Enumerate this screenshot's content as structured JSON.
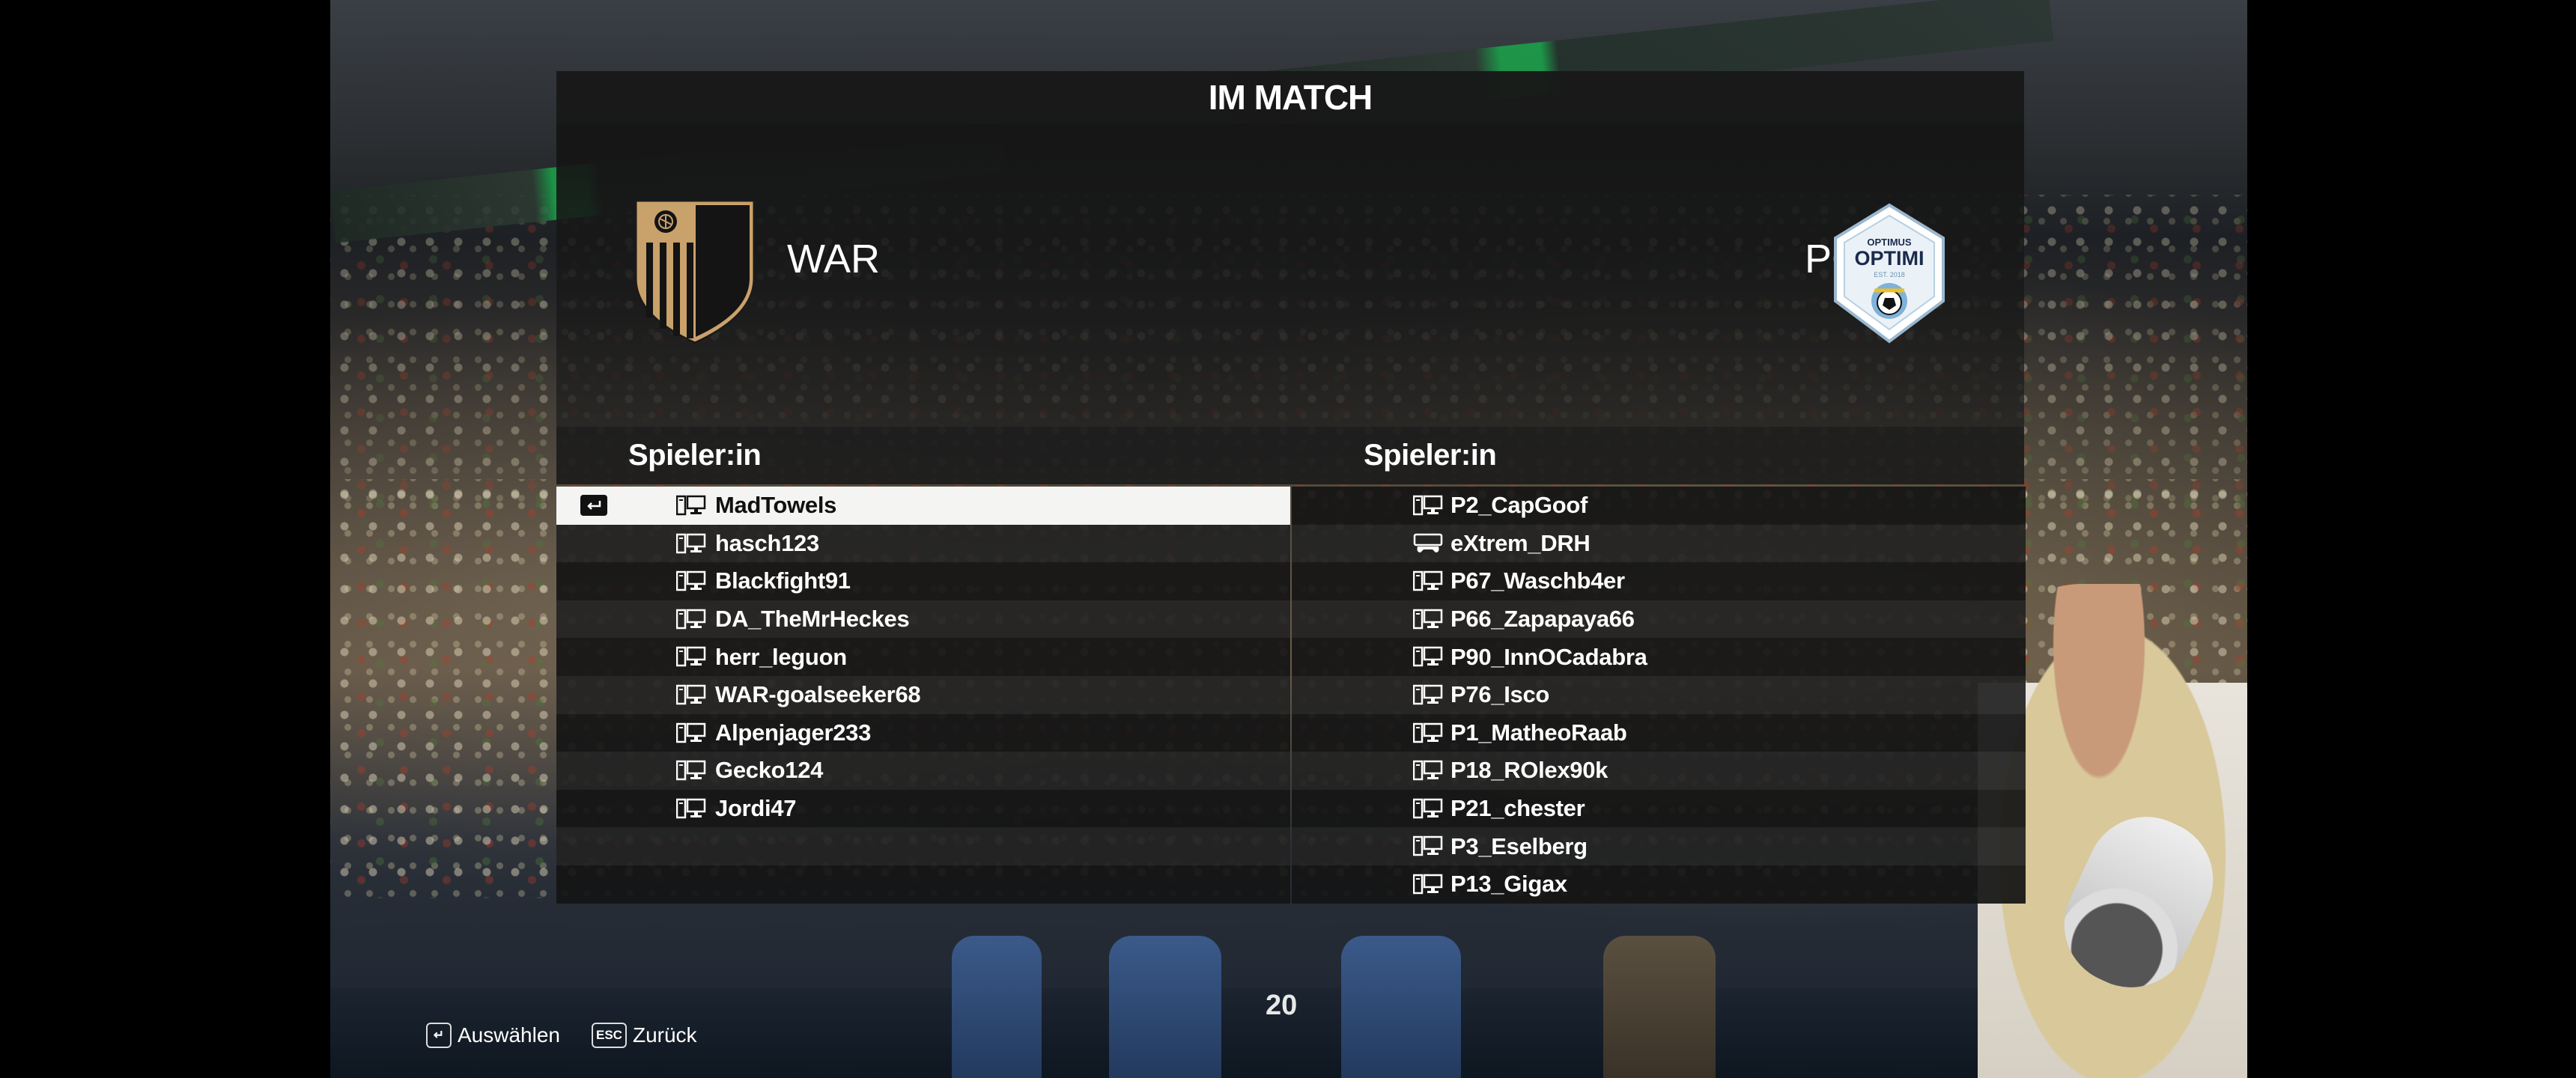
{
  "screen_title": "IM MATCH",
  "home_team": {
    "name": "WAR",
    "crest_icon": "war-shield-crest"
  },
  "away_team": {
    "name": "PG",
    "crest_icon": "optimus-optimi-crest",
    "crest_text_top": "OPTIMUS",
    "crest_text_main": "OPTIMI",
    "crest_text_sub": "EST. 2018"
  },
  "home_column_header": "Spieler:in",
  "away_column_header": "Spieler:in",
  "home_players": [
    {
      "name": "MadTowels",
      "platform": "pc-icon",
      "selected": true
    },
    {
      "name": "hasch123",
      "platform": "pc-icon"
    },
    {
      "name": "Blackfight91",
      "platform": "pc-icon"
    },
    {
      "name": "DA_TheMrHeckes",
      "platform": "pc-icon"
    },
    {
      "name": "herr_leguon",
      "platform": "pc-icon"
    },
    {
      "name": "WAR-goalseeker68",
      "platform": "pc-icon"
    },
    {
      "name": "Alpenjager233",
      "platform": "pc-icon"
    },
    {
      "name": "Gecko124",
      "platform": "pc-icon"
    },
    {
      "name": "Jordi47",
      "platform": "pc-icon"
    }
  ],
  "away_players": [
    {
      "name": "P2_CapGoof",
      "platform": "pc-icon"
    },
    {
      "name": "eXtrem_DRH",
      "platform": "console-icon"
    },
    {
      "name": "P67_Waschb4er",
      "platform": "pc-icon"
    },
    {
      "name": "P66_Zapapaya66",
      "platform": "pc-icon"
    },
    {
      "name": "P90_InnOCadabra",
      "platform": "pc-icon"
    },
    {
      "name": "P76_Isco",
      "platform": "pc-icon"
    },
    {
      "name": "P1_MatheoRaab",
      "platform": "pc-icon"
    },
    {
      "name": "P18_ROlex90k",
      "platform": "pc-icon"
    },
    {
      "name": "P21_chester",
      "platform": "pc-icon"
    },
    {
      "name": "P3_Eselberg",
      "platform": "pc-icon"
    },
    {
      "name": "P13_Gigax",
      "platform": "pc-icon"
    }
  ],
  "footer": {
    "select_key": "↵",
    "select_label": "Auswählen",
    "back_key": "ESC",
    "back_label": "Zurück"
  },
  "background_kit_number": "20",
  "colors": {
    "selected_row": "#f4f4f2",
    "crest_gold": "#c9a16a",
    "row_dark": "#141414",
    "row_light": "#222222"
  }
}
